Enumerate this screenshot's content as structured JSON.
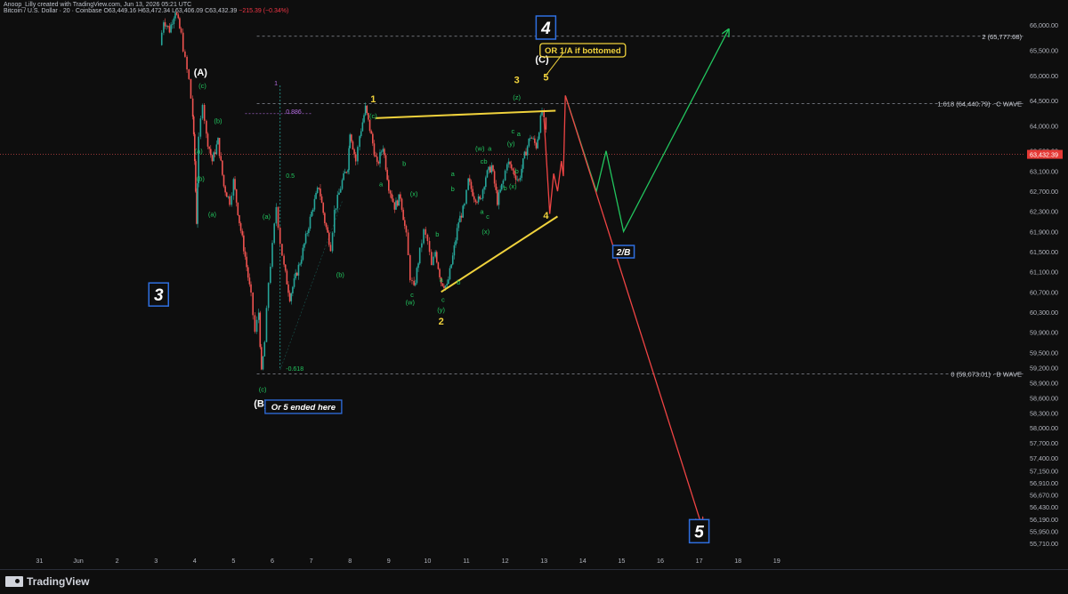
{
  "header": {
    "attribution": "Anoop_Lilly created with TradingView.com, Jun 13, 2026 05:21 UTC",
    "symbol": "Bitcoin / U.S. Dollar · 20 · Coinbase",
    "ohlc": "O63,449.16  H63,472.34  L63,406.09  C63,432.39",
    "change": "−215.39 (−0.34%)"
  },
  "footer": {
    "brand": "TradingView"
  },
  "colors": {
    "background": "#0e0e0e",
    "up": "#26a69a",
    "down": "#ef5350",
    "wave_yellow": "#f0d23c",
    "wave_green": "#22c55e",
    "wave_red": "#ef4444",
    "box_blue": "#2f6fe0",
    "fib_purple": "#b36be0",
    "price_badge": "#e53935"
  },
  "chart_data": {
    "type": "candlestick",
    "title": "Bitcoin / U.S. Dollar · 20 · Coinbase",
    "ylim": [
      55550,
      66250
    ],
    "y_ticks": [
      {
        "value": 66000,
        "label": "66,000.00"
      },
      {
        "value": 65500,
        "label": "65,500.00"
      },
      {
        "value": 65000,
        "label": "65,000.00"
      },
      {
        "value": 64500,
        "label": "64,500.00"
      },
      {
        "value": 64000,
        "label": "64,000.00"
      },
      {
        "value": 63500,
        "label": "63,500.00"
      },
      {
        "value": 63100,
        "label": "63,100.00"
      },
      {
        "value": 62700,
        "label": "62,700.00"
      },
      {
        "value": 62300,
        "label": "62,300.00"
      },
      {
        "value": 61900,
        "label": "61,900.00"
      },
      {
        "value": 61500,
        "label": "61,500.00"
      },
      {
        "value": 61100,
        "label": "61,100.00"
      },
      {
        "value": 60700,
        "label": "60,700.00"
      },
      {
        "value": 60300,
        "label": "60,300.00"
      },
      {
        "value": 59900,
        "label": "59,900.00"
      },
      {
        "value": 59500,
        "label": "59,500.00"
      },
      {
        "value": 59200,
        "label": "59,200.00"
      },
      {
        "value": 58900,
        "label": "58,900.00"
      },
      {
        "value": 58600,
        "label": "58,600.00"
      },
      {
        "value": 58300,
        "label": "58,300.00"
      },
      {
        "value": 58000,
        "label": "58,000.00"
      },
      {
        "value": 57700,
        "label": "57,700.00"
      },
      {
        "value": 57400,
        "label": "57,400.00"
      },
      {
        "value": 57150,
        "label": "57,150.00"
      },
      {
        "value": 56910,
        "label": "56,910.00"
      },
      {
        "value": 56670,
        "label": "56,670.00"
      },
      {
        "value": 56430,
        "label": "56,430.00"
      },
      {
        "value": 56190,
        "label": "56,190.00"
      },
      {
        "value": 55950,
        "label": "55,950.00"
      },
      {
        "value": 55710,
        "label": "55,710.00"
      }
    ],
    "x_ticks": [
      {
        "day": -1,
        "label": "31"
      },
      {
        "day": 0,
        "label": "Jun"
      },
      {
        "day": 1,
        "label": "2"
      },
      {
        "day": 2,
        "label": "3"
      },
      {
        "day": 3,
        "label": "4"
      },
      {
        "day": 4,
        "label": "5"
      },
      {
        "day": 5,
        "label": "6"
      },
      {
        "day": 6,
        "label": "7"
      },
      {
        "day": 7,
        "label": "8"
      },
      {
        "day": 8,
        "label": "9"
      },
      {
        "day": 9,
        "label": "10"
      },
      {
        "day": 10,
        "label": "11"
      },
      {
        "day": 11,
        "label": "12"
      },
      {
        "day": 12,
        "label": "13"
      },
      {
        "day": 13,
        "label": "14"
      },
      {
        "day": 14,
        "label": "15"
      },
      {
        "day": 15,
        "label": "16"
      },
      {
        "day": 16,
        "label": "17"
      },
      {
        "day": 17,
        "label": "18"
      },
      {
        "day": 18,
        "label": "19"
      }
    ],
    "current_price": {
      "value": 63432.39,
      "label": "63,432.39"
    },
    "price_path": [
      [
        2.1,
        65600
      ],
      [
        2.2,
        66100
      ],
      [
        2.35,
        65900
      ],
      [
        2.5,
        66300
      ],
      [
        2.65,
        65800
      ],
      [
        2.75,
        65300
      ],
      [
        2.85,
        64900
      ],
      [
        2.95,
        64200
      ],
      [
        3.0,
        63300
      ],
      [
        3.05,
        62100
      ],
      [
        3.1,
        63700
      ],
      [
        3.2,
        64500
      ],
      [
        3.3,
        63800
      ],
      [
        3.45,
        63300
      ],
      [
        3.6,
        63700
      ],
      [
        3.75,
        62800
      ],
      [
        3.9,
        62500
      ],
      [
        4.0,
        62900
      ],
      [
        4.15,
        62100
      ],
      [
        4.3,
        61400
      ],
      [
        4.45,
        60600
      ],
      [
        4.55,
        59900
      ],
      [
        4.65,
        60300
      ],
      [
        4.72,
        59073
      ],
      [
        4.8,
        59700
      ],
      [
        4.9,
        60900
      ],
      [
        5.0,
        61600
      ],
      [
        5.1,
        62400
      ],
      [
        5.2,
        61700
      ],
      [
        5.3,
        61200
      ],
      [
        5.45,
        60600
      ],
      [
        5.6,
        61000
      ],
      [
        5.75,
        61400
      ],
      [
        5.9,
        61900
      ],
      [
        6.05,
        62400
      ],
      [
        6.2,
        62800
      ],
      [
        6.35,
        62100
      ],
      [
        6.5,
        61600
      ],
      [
        6.6,
        62300
      ],
      [
        6.8,
        62900
      ],
      [
        6.95,
        63200
      ],
      [
        7.0,
        63900
      ],
      [
        7.15,
        63300
      ],
      [
        7.25,
        63800
      ],
      [
        7.4,
        64350
      ],
      [
        7.55,
        63800
      ],
      [
        7.7,
        63200
      ],
      [
        7.85,
        63600
      ],
      [
        8.0,
        62800
      ],
      [
        8.15,
        62400
      ],
      [
        8.3,
        62600
      ],
      [
        8.45,
        61800
      ],
      [
        8.55,
        61000
      ],
      [
        8.65,
        60750
      ],
      [
        8.8,
        61500
      ],
      [
        8.9,
        61900
      ],
      [
        9.0,
        61700
      ],
      [
        9.1,
        61200
      ],
      [
        9.2,
        61500
      ],
      [
        9.35,
        60900
      ],
      [
        9.5,
        60800
      ],
      [
        9.65,
        61400
      ],
      [
        9.8,
        62100
      ],
      [
        9.95,
        62400
      ],
      [
        10.05,
        62900
      ],
      [
        10.2,
        62600
      ],
      [
        10.35,
        62500
      ],
      [
        10.5,
        63000
      ],
      [
        10.65,
        63200
      ],
      [
        10.8,
        62500
      ],
      [
        10.95,
        62900
      ],
      [
        11.05,
        63300
      ],
      [
        11.2,
        63100
      ],
      [
        11.35,
        62900
      ],
      [
        11.5,
        63400
      ],
      [
        11.65,
        63800
      ],
      [
        11.8,
        63600
      ],
      [
        11.95,
        64300
      ],
      [
        12.05,
        63850
      ]
    ],
    "fib_levels": [
      {
        "value": 65777.68,
        "label": "2 (65,777.68)"
      },
      {
        "value": 64440.79,
        "label": "1.618 (64,440.79) · C WAVE"
      },
      {
        "value": 59073.01,
        "label": "0 (59,073.01) · B WAVE"
      }
    ],
    "fib_tool_labels": [
      {
        "day": 5.05,
        "value": 64800,
        "label": "1"
      },
      {
        "day": 5.35,
        "value": 64240,
        "label": "0.886"
      },
      {
        "day": 5.35,
        "value": 62970,
        "label": "0.5"
      },
      {
        "day": 5.35,
        "value": 59130,
        "label": "-0.618"
      }
    ],
    "trendlines": [
      {
        "name": "triangle-upper",
        "color": "yellow",
        "from": [
          7.65,
          64150
        ],
        "to": [
          12.3,
          64300
        ]
      },
      {
        "name": "triangle-lower",
        "color": "yellow",
        "from": [
          9.35,
          60700
        ],
        "to": [
          12.35,
          62200
        ]
      }
    ],
    "projections": [
      {
        "name": "bullish-path",
        "color": "green",
        "points": [
          [
            12.55,
            64600
          ],
          [
            13.35,
            62700
          ],
          [
            13.6,
            63500
          ],
          [
            14.05,
            61900
          ],
          [
            16.75,
            65900
          ]
        ]
      },
      {
        "name": "bearish-path",
        "color": "red",
        "points": [
          [
            12.0,
            64150
          ],
          [
            12.15,
            62250
          ],
          [
            12.25,
            63050
          ],
          [
            12.35,
            62700
          ],
          [
            12.45,
            63300
          ],
          [
            12.5,
            63000
          ],
          [
            12.55,
            64600
          ],
          [
            16.05,
            56100
          ]
        ]
      }
    ],
    "wave_labels": [
      {
        "day": 3.15,
        "value": 65000,
        "text": "(A)",
        "color": "white",
        "bold": true
      },
      {
        "day": 3.2,
        "value": 64750,
        "text": "(c)",
        "color": "green"
      },
      {
        "day": 3.6,
        "value": 64050,
        "text": "(b)",
        "color": "green"
      },
      {
        "day": 3.1,
        "value": 63450,
        "text": "(a)",
        "color": "green"
      },
      {
        "day": 3.15,
        "value": 62900,
        "text": "(b)",
        "color": "green"
      },
      {
        "day": 3.45,
        "value": 62200,
        "text": "(a)",
        "color": "green"
      },
      {
        "day": 4.85,
        "value": 62150,
        "text": "(a)",
        "color": "green"
      },
      {
        "day": 6.75,
        "value": 61000,
        "text": "(b)",
        "color": "green"
      },
      {
        "day": 4.75,
        "value": 58720,
        "text": "(c)",
        "color": "green"
      },
      {
        "day": 4.7,
        "value": 58420,
        "text": "(B)",
        "color": "white",
        "bold": true
      },
      {
        "day": 7.6,
        "value": 64470,
        "text": "1",
        "color": "yellow",
        "bold": true
      },
      {
        "day": 7.6,
        "value": 64150,
        "text": "(c)",
        "color": "green"
      },
      {
        "day": 7.8,
        "value": 62800,
        "text": "a",
        "color": "green"
      },
      {
        "day": 8.4,
        "value": 63200,
        "text": "b",
        "color": "green"
      },
      {
        "day": 8.65,
        "value": 62600,
        "text": "(x)",
        "color": "green"
      },
      {
        "day": 8.6,
        "value": 60600,
        "text": "c",
        "color": "green"
      },
      {
        "day": 8.55,
        "value": 60450,
        "text": "(w)",
        "color": "green"
      },
      {
        "day": 9.25,
        "value": 61800,
        "text": "b",
        "color": "green"
      },
      {
        "day": 9.35,
        "value": 60900,
        "text": "a",
        "color": "green"
      },
      {
        "day": 9.8,
        "value": 60850,
        "text": "b",
        "color": "green"
      },
      {
        "day": 9.4,
        "value": 60500,
        "text": "c",
        "color": "green"
      },
      {
        "day": 9.35,
        "value": 60300,
        "text": "(y)",
        "color": "green"
      },
      {
        "day": 9.35,
        "value": 60050,
        "text": "2",
        "color": "yellow",
        "bold": true
      },
      {
        "day": 9.65,
        "value": 63000,
        "text": "a",
        "color": "green"
      },
      {
        "day": 9.65,
        "value": 62700,
        "text": "b",
        "color": "green"
      },
      {
        "day": 10.4,
        "value": 62250,
        "text": "a",
        "color": "green"
      },
      {
        "day": 10.55,
        "value": 62150,
        "text": "c",
        "color": "green"
      },
      {
        "day": 10.5,
        "value": 61850,
        "text": "(x)",
        "color": "green"
      },
      {
        "day": 10.35,
        "value": 63500,
        "text": "(w)",
        "color": "green"
      },
      {
        "day": 10.6,
        "value": 63500,
        "text": "a",
        "color": "green"
      },
      {
        "day": 10.45,
        "value": 63250,
        "text": "cb",
        "color": "green"
      },
      {
        "day": 11.0,
        "value": 62720,
        "text": "b",
        "color": "green"
      },
      {
        "day": 11.2,
        "value": 62750,
        "text": "(x)",
        "color": "green"
      },
      {
        "day": 11.15,
        "value": 63600,
        "text": "(y)",
        "color": "green"
      },
      {
        "day": 11.2,
        "value": 63850,
        "text": "c",
        "color": "green"
      },
      {
        "day": 11.35,
        "value": 63800,
        "text": "a",
        "color": "green"
      },
      {
        "day": 11.3,
        "value": 63050,
        "text": "b",
        "color": "green"
      },
      {
        "day": 11.3,
        "value": 64520,
        "text": "(z)",
        "color": "green"
      },
      {
        "day": 11.3,
        "value": 64850,
        "text": "3",
        "color": "yellow",
        "bold": true
      },
      {
        "day": 12.05,
        "value": 62150,
        "text": "4",
        "color": "yellow",
        "bold": true
      },
      {
        "day": 11.95,
        "value": 65250,
        "text": "(C)",
        "color": "white",
        "bold": true
      },
      {
        "day": 12.05,
        "value": 64900,
        "text": "5",
        "color": "yellow",
        "bold": true
      }
    ],
    "wave_boxes": [
      {
        "day": 2.07,
        "value": 60650,
        "text": "3",
        "size": "large"
      },
      {
        "day": 12.05,
        "value": 65950,
        "text": "4",
        "size": "large"
      },
      {
        "day": 14.05,
        "value": 61500,
        "text": "2/B",
        "size": "small"
      },
      {
        "day": 16.0,
        "value": 55950,
        "text": "5",
        "size": "large"
      }
    ],
    "callouts": [
      {
        "day": 13.0,
        "value": 65500,
        "text": "OR 1/A if bottomed",
        "style": "yellow"
      },
      {
        "day": 5.8,
        "value": 58420,
        "text": "Or 5 ended here",
        "style": "blue"
      }
    ]
  }
}
